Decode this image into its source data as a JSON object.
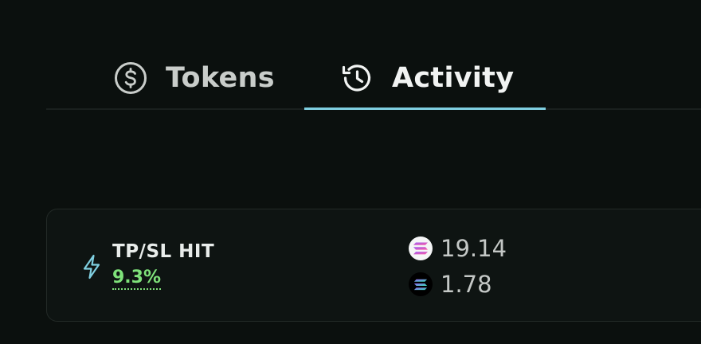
{
  "tabs": [
    {
      "id": "tokens",
      "label": "Tokens",
      "icon": "dollar-circle-icon",
      "active": false
    },
    {
      "id": "activity",
      "label": "Activity",
      "icon": "history-icon",
      "active": true
    }
  ],
  "colors": {
    "background": "#0b100e",
    "active_tab_underline": "#7fcfe0",
    "positive": "#7fe27a",
    "bolt": "#7fcfe0"
  },
  "activity": {
    "items": [
      {
        "type_icon": "lightning-bolt-icon",
        "title": "TP/SL HIT",
        "percent": "9.3%",
        "amounts": [
          {
            "token_icon": "solana-icon",
            "value": "19.14"
          },
          {
            "token_icon": "solana-icon",
            "value": "1.78"
          }
        ]
      }
    ]
  }
}
